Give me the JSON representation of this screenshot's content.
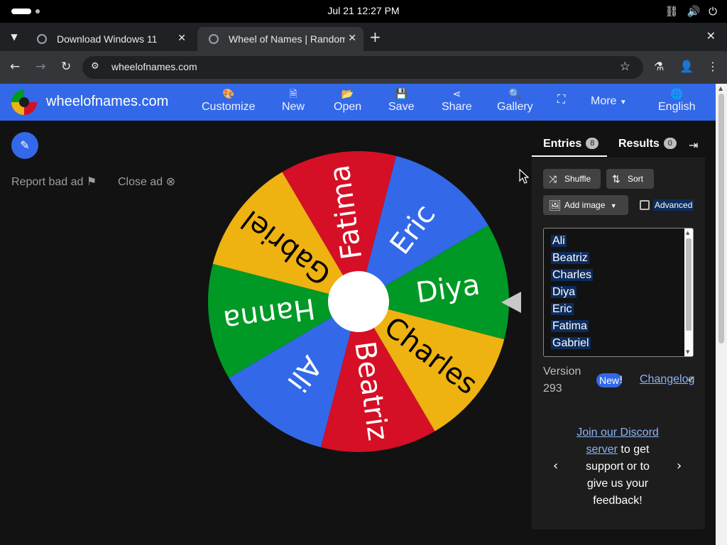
{
  "system": {
    "clock": "Jul 21  12:27 PM"
  },
  "browser": {
    "tabs": [
      {
        "title": "Download Windows 11"
      },
      {
        "title": "Wheel of Names | Random Name Picker"
      }
    ],
    "url": "wheelofnames.com"
  },
  "app": {
    "brand": "wheelofnames.com",
    "menu": [
      "Customize",
      "New",
      "Open",
      "Save",
      "Share",
      "Gallery",
      "More",
      "English"
    ],
    "report_ad": "Report bad ad",
    "close_ad": "Close ad"
  },
  "wheel": {
    "colors": {
      "blue": "#3369e8",
      "red": "#d50f25",
      "yellow": "#eeb211",
      "green": "#009925"
    },
    "segments": [
      "Eric",
      "Fatima",
      "Gabriel",
      "Hanna",
      "Ali",
      "Beatriz",
      "Charles",
      "Diya"
    ]
  },
  "panel": {
    "tab_entries": "Entries",
    "entries_count": "8",
    "tab_results": "Results",
    "results_count": "0",
    "shuffle": "Shuffle",
    "sort": "Sort",
    "add_image": "Add image",
    "advanced": "Advanced",
    "entries": [
      "Ali",
      "Beatriz",
      "Charles",
      "Diya",
      "Eric",
      "Fatima",
      "Gabriel"
    ],
    "version_label": "Version",
    "version_number": "293",
    "new_badge": "New",
    "new_bang": "!",
    "changelog": "Changelog",
    "discord_link_1": "Join our Discord",
    "discord_link_2": "server",
    "discord_text_1": " to get",
    "discord_text_2": "support or to",
    "discord_text_3": "give us your",
    "discord_text_4": "feedback!"
  }
}
